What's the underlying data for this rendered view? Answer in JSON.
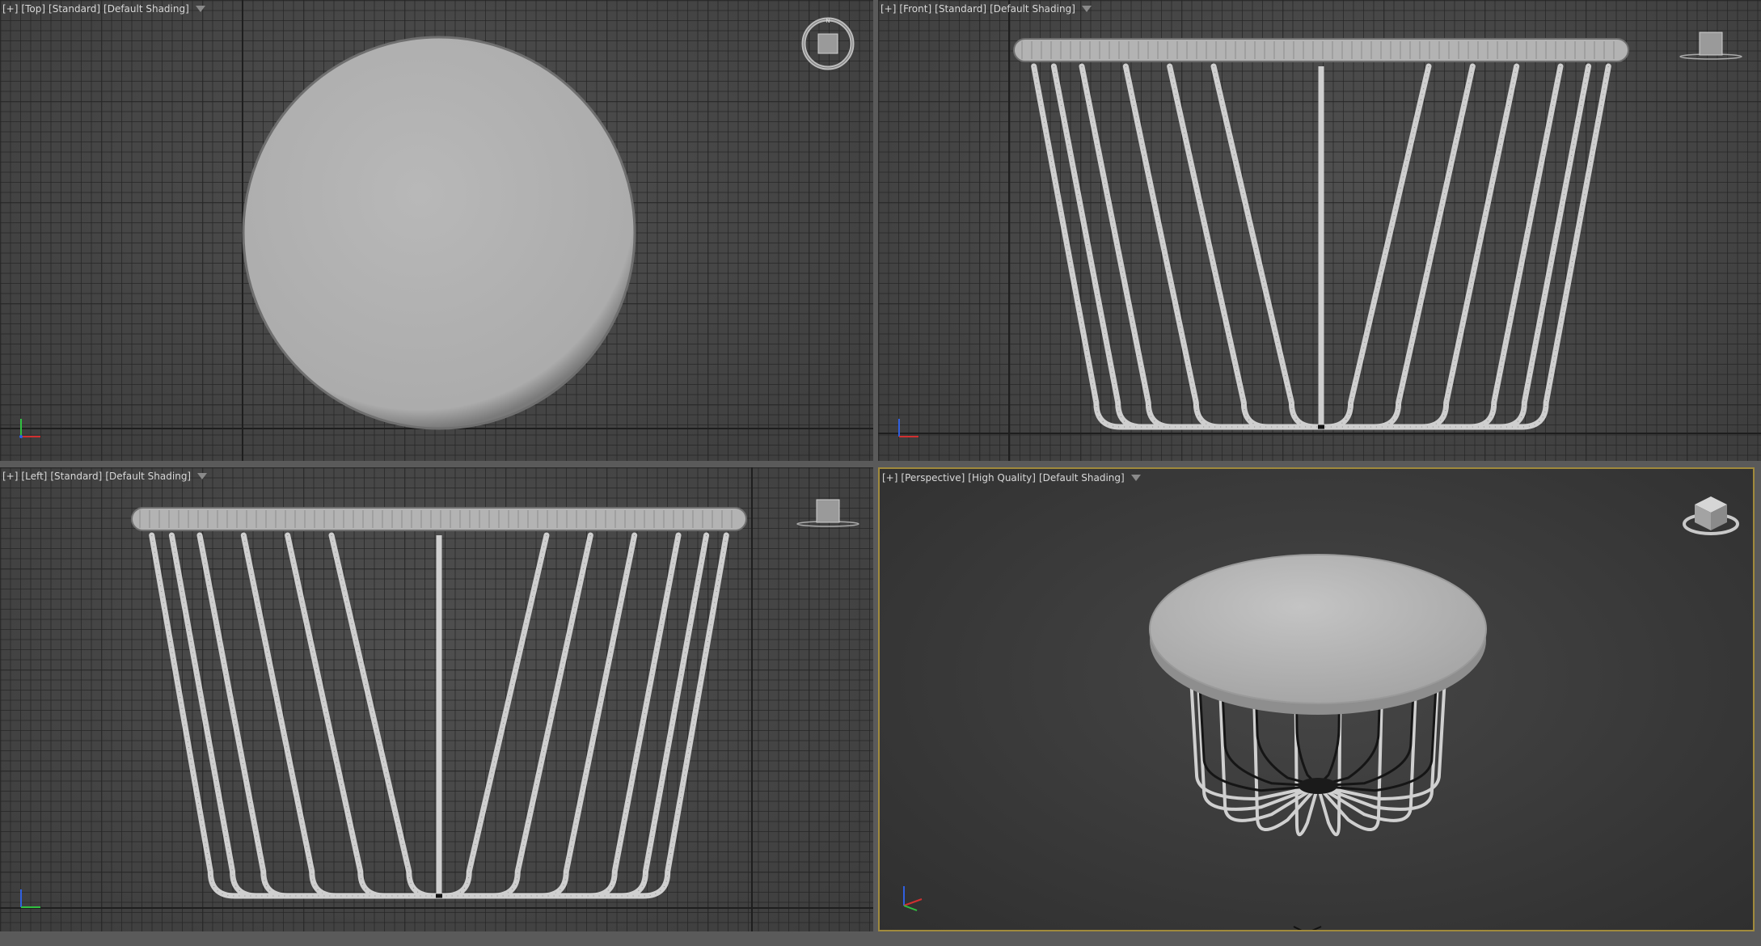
{
  "viewports": {
    "top": {
      "plus": "[+]",
      "view": "[Top]",
      "mode": "[Standard]",
      "shading": "[Default Shading]"
    },
    "front": {
      "plus": "[+]",
      "view": "[Front]",
      "mode": "[Standard]",
      "shading": "[Default Shading]"
    },
    "left": {
      "plus": "[+]",
      "view": "[Left]",
      "mode": "[Standard]",
      "shading": "[Default Shading]"
    },
    "perspective": {
      "plus": "[+]",
      "view": "[Perspective]",
      "mode": "[High Quality]",
      "shading": "[Default Shading]"
    }
  },
  "icons": {
    "viewcube": "viewcube-icon",
    "filter": "filter-icon",
    "axis_tripod": "axis-tripod-icon"
  },
  "colors": {
    "active_viewport_border": "#a08a3c",
    "table_surface": "#b4b4b4",
    "wire": "#d2d2d2",
    "axis_x": "#d03030",
    "axis_y": "#30c040",
    "axis_z": "#3060e0"
  }
}
